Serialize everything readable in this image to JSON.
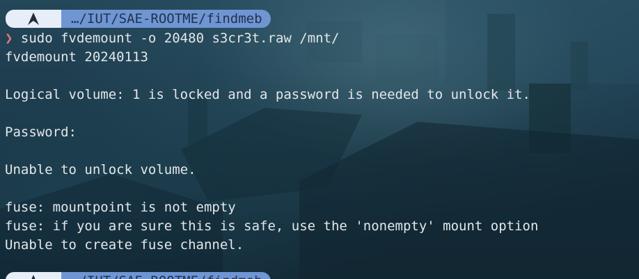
{
  "prompt": {
    "os_icon": "arch-linux-icon",
    "path": "…/IUT/SAE-ROOTME/findmeb",
    "symbol": "❯",
    "command": "sudo fvdemount -o 20480 s3cr3t.raw /mnt/"
  },
  "output_lines": [
    "fvdemount 20240113",
    "",
    "Logical volume: 1 is locked and a password is needed to unlock it.",
    "",
    "Password:",
    "",
    "Unable to unlock volume.",
    "",
    "fuse: mountpoint is not empty",
    "fuse: if you are sure this is safe, use the 'nonempty' mount option",
    "Unable to create fuse channel."
  ],
  "next_prompt": {
    "path": "…/IUT/SAE-ROOTME/findmeb"
  },
  "colors": {
    "prompt_symbol": "#e07a7a",
    "path_segment": "#6f95d3",
    "os_segment": "#e7eef7",
    "text": "#e3e8ea"
  }
}
